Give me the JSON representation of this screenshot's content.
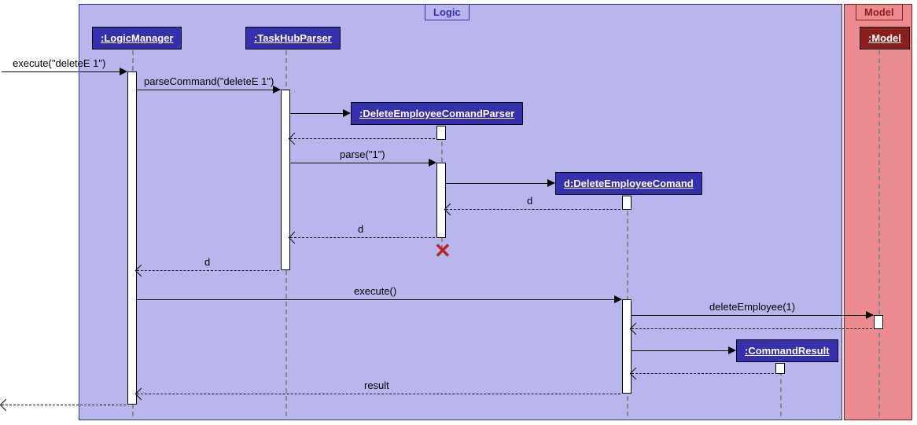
{
  "frames": {
    "logic": {
      "label": "Logic",
      "color_fill": "#b9b6ee",
      "color_border": "#3530ad"
    },
    "model": {
      "label": "Model",
      "color_fill": "#ec8b90",
      "color_border": "#8d1e1e"
    }
  },
  "lifelines": {
    "logicManager": ":LogicManager",
    "taskHubParser": ":TaskHubParser",
    "deleteParser": ":DeleteEmployeeComandParser",
    "deleteCommand": "d:DeleteEmployeeComand",
    "commandResult": ":CommandResult",
    "model": ":Model"
  },
  "messages": {
    "m1": "execute(\"deleteE 1\")",
    "m2": "parseCommand(\"deleteE 1\")",
    "m3": "parse(\"1\")",
    "r1": "d",
    "r2": "d",
    "r3": "d",
    "m4": "execute()",
    "m5": "deleteEmployee(1)",
    "r4": "result"
  },
  "chart_data": {
    "type": "sequence_diagram",
    "frames": [
      {
        "name": "Logic",
        "contains": [
          ":LogicManager",
          ":TaskHubParser",
          ":DeleteEmployeeComandParser",
          "d:DeleteEmployeeComand",
          ":CommandResult"
        ]
      },
      {
        "name": "Model",
        "contains": [
          ":Model"
        ]
      }
    ],
    "participants": [
      {
        "id": "caller",
        "label": "(external)"
      },
      {
        "id": "lm",
        "label": ":LogicManager"
      },
      {
        "id": "thp",
        "label": ":TaskHubParser"
      },
      {
        "id": "decp",
        "label": ":DeleteEmployeeComandParser",
        "created_by_message": 2
      },
      {
        "id": "dec",
        "label": "d:DeleteEmployeeComand",
        "created_by_message": 4
      },
      {
        "id": "model",
        "label": ":Model"
      },
      {
        "id": "cr",
        "label": ":CommandResult",
        "created_by_message": 10
      }
    ],
    "messages": [
      {
        "n": 1,
        "from": "caller",
        "to": "lm",
        "label": "execute(\"deleteE 1\")",
        "type": "sync"
      },
      {
        "n": 2,
        "from": "lm",
        "to": "thp",
        "label": "parseCommand(\"deleteE 1\")",
        "type": "sync"
      },
      {
        "n": 3,
        "from": "thp",
        "to": "decp",
        "label": "",
        "type": "create"
      },
      {
        "n": 4,
        "from": "decp",
        "to": "thp",
        "label": "",
        "type": "return"
      },
      {
        "n": 5,
        "from": "thp",
        "to": "decp",
        "label": "parse(\"1\")",
        "type": "sync"
      },
      {
        "n": 6,
        "from": "decp",
        "to": "dec",
        "label": "",
        "type": "create"
      },
      {
        "n": 7,
        "from": "dec",
        "to": "decp",
        "label": "d",
        "type": "return"
      },
      {
        "n": 8,
        "from": "decp",
        "to": "thp",
        "label": "d",
        "type": "return"
      },
      {
        "n": 9,
        "from": "decp",
        "to": null,
        "label": "",
        "type": "destroy"
      },
      {
        "n": 10,
        "from": "thp",
        "to": "lm",
        "label": "d",
        "type": "return"
      },
      {
        "n": 11,
        "from": "lm",
        "to": "dec",
        "label": "execute()",
        "type": "sync"
      },
      {
        "n": 12,
        "from": "dec",
        "to": "model",
        "label": "deleteEmployee(1)",
        "type": "sync"
      },
      {
        "n": 13,
        "from": "model",
        "to": "dec",
        "label": "",
        "type": "return"
      },
      {
        "n": 14,
        "from": "dec",
        "to": "cr",
        "label": "",
        "type": "create"
      },
      {
        "n": 15,
        "from": "cr",
        "to": "dec",
        "label": "",
        "type": "return"
      },
      {
        "n": 16,
        "from": "dec",
        "to": "lm",
        "label": "result",
        "type": "return"
      },
      {
        "n": 17,
        "from": "lm",
        "to": "caller",
        "label": "",
        "type": "return"
      }
    ]
  }
}
